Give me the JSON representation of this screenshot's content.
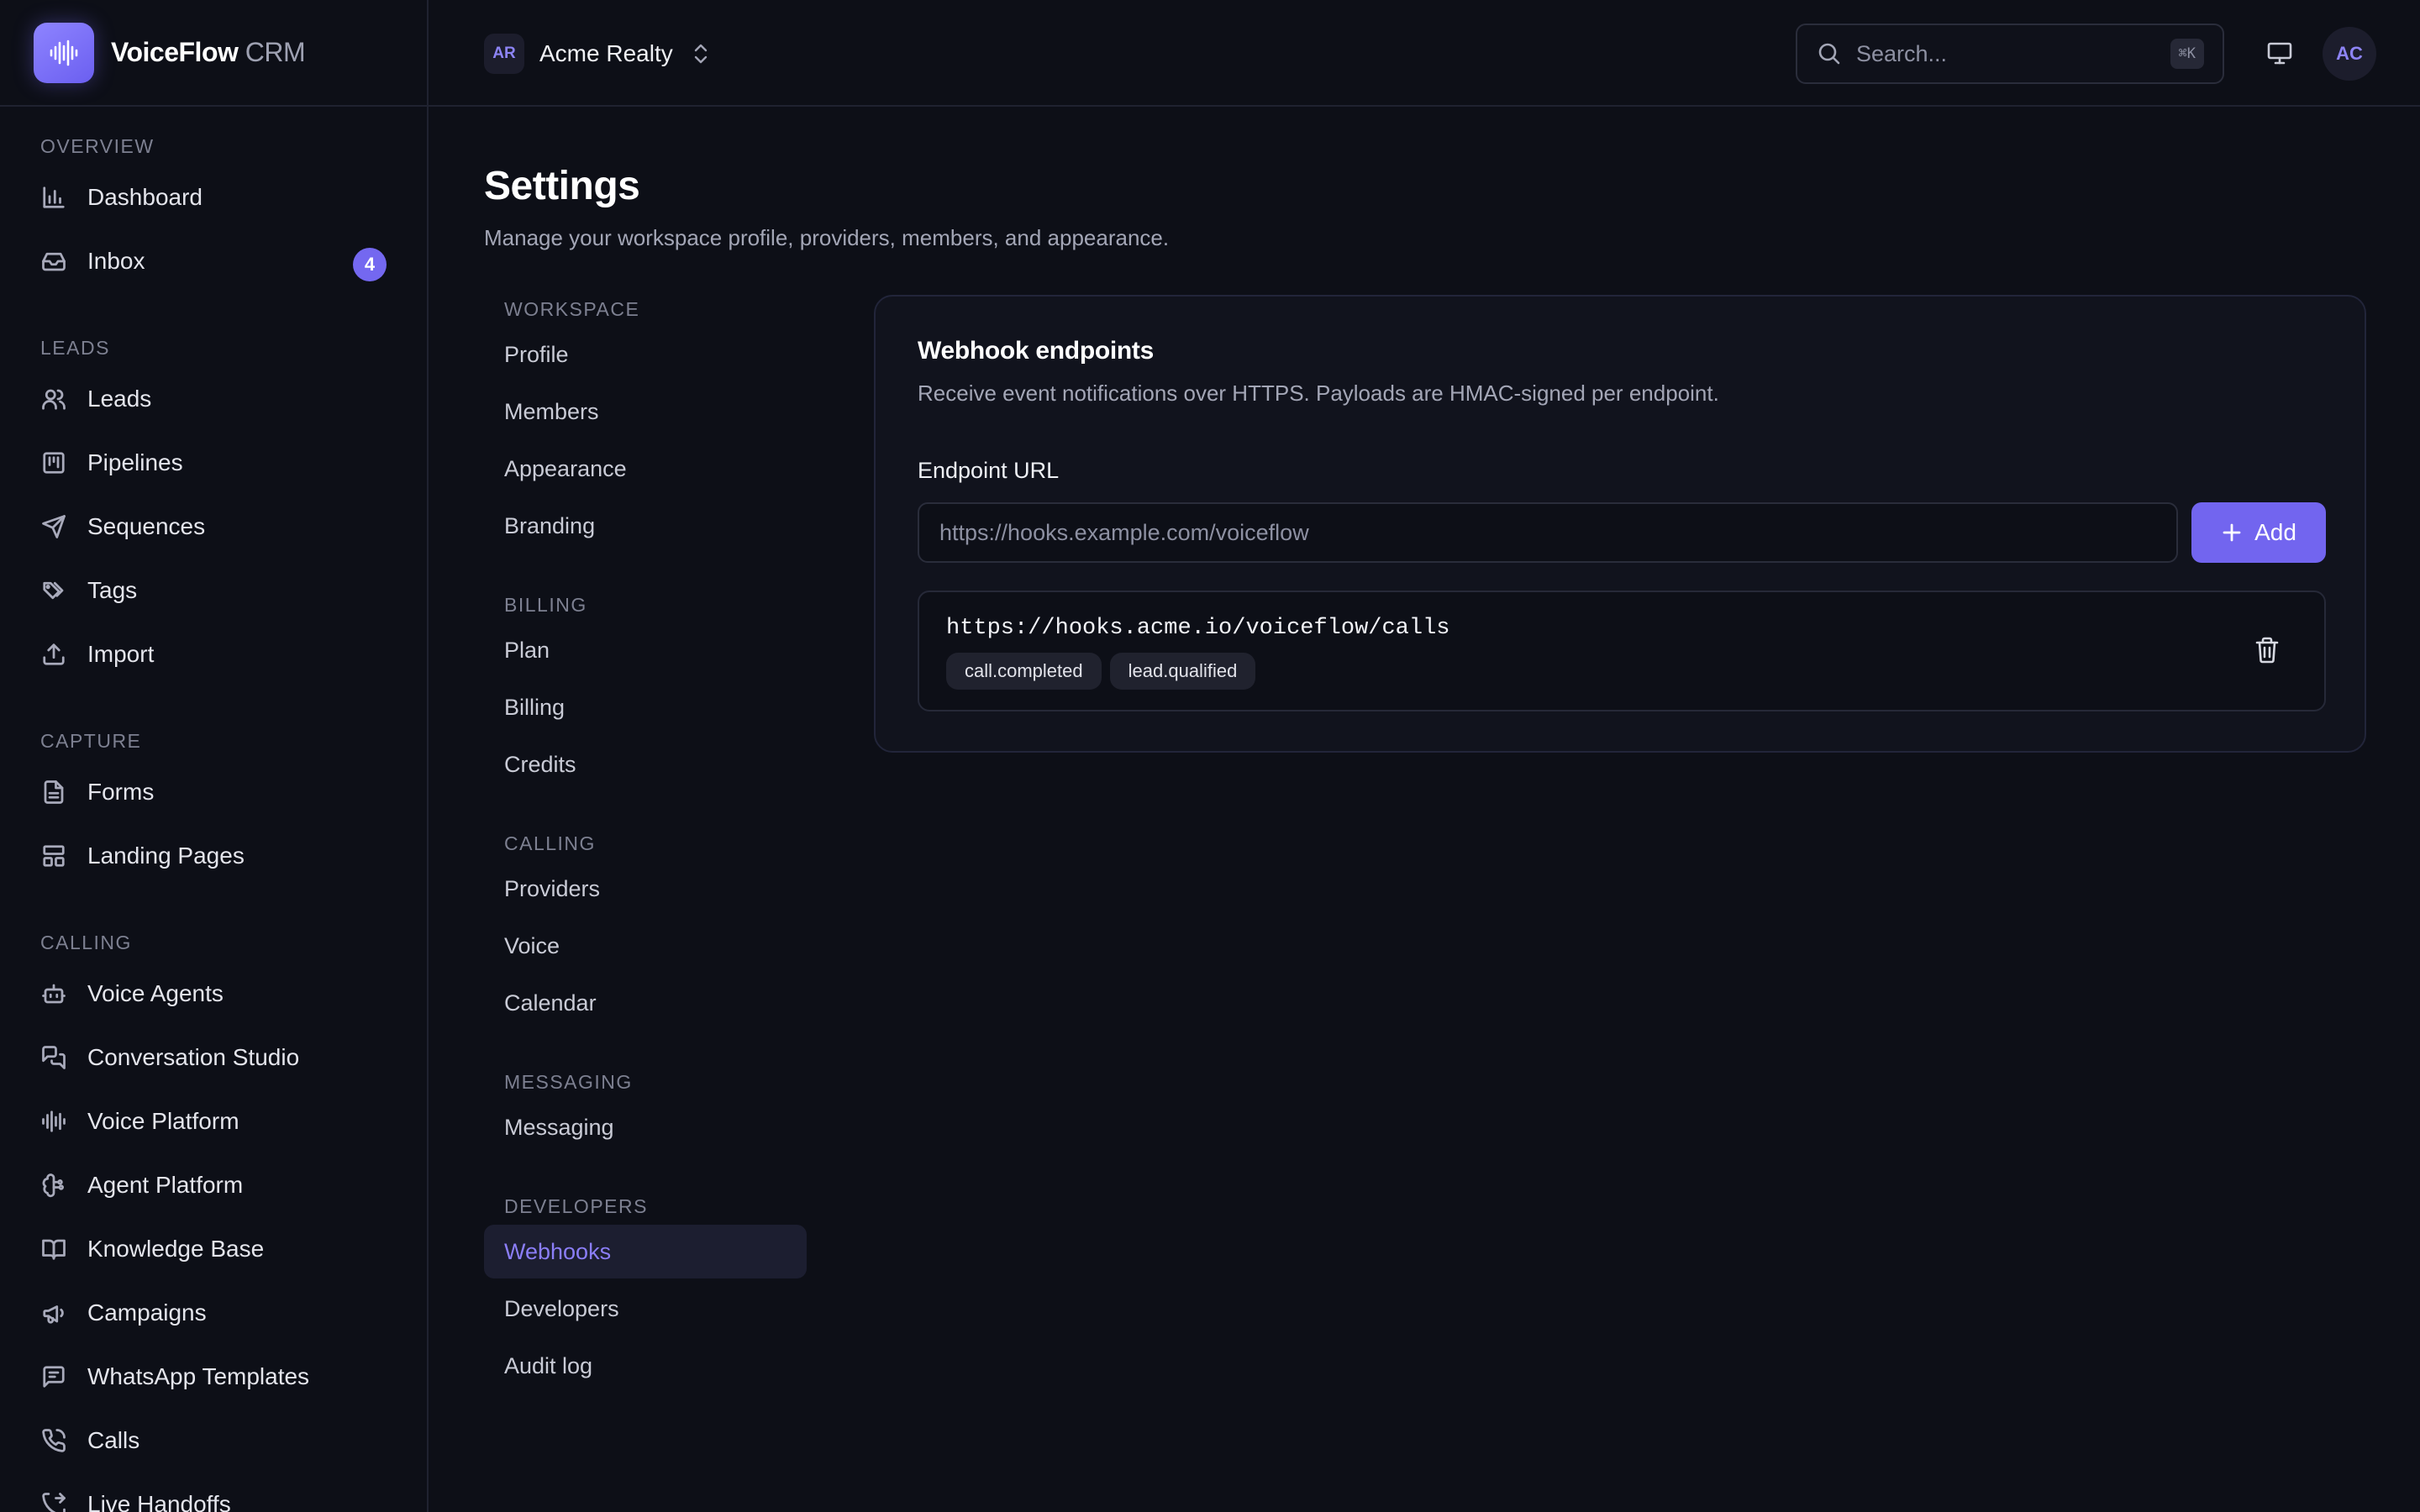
{
  "app": {
    "name": "VoiceFlow",
    "name_suffix": "CRM",
    "accent": "#7468f0",
    "background": "#0d0f17"
  },
  "sidebar": {
    "sections": [
      {
        "label": "OVERVIEW",
        "items": [
          {
            "label": "Dashboard",
            "icon": "bar-chart-icon"
          },
          {
            "label": "Inbox",
            "icon": "inbox-icon",
            "badge": "4"
          }
        ]
      },
      {
        "label": "LEADS",
        "items": [
          {
            "label": "Leads",
            "icon": "users-icon"
          },
          {
            "label": "Pipelines",
            "icon": "kanban-icon"
          },
          {
            "label": "Sequences",
            "icon": "send-icon"
          },
          {
            "label": "Tags",
            "icon": "tags-icon"
          },
          {
            "label": "Import",
            "icon": "upload-icon"
          }
        ]
      },
      {
        "label": "CAPTURE",
        "items": [
          {
            "label": "Forms",
            "icon": "file-text-icon"
          },
          {
            "label": "Landing Pages",
            "icon": "layout-icon"
          }
        ]
      },
      {
        "label": "CALLING",
        "items": [
          {
            "label": "Voice Agents",
            "icon": "bot-icon"
          },
          {
            "label": "Conversation Studio",
            "icon": "messages-icon"
          },
          {
            "label": "Voice Platform",
            "icon": "audio-lines-icon"
          },
          {
            "label": "Agent Platform",
            "icon": "brain-icon"
          },
          {
            "label": "Knowledge Base",
            "icon": "book-open-icon"
          },
          {
            "label": "Campaigns",
            "icon": "megaphone-icon"
          },
          {
            "label": "WhatsApp Templates",
            "icon": "message-square-icon"
          },
          {
            "label": "Calls",
            "icon": "phone-icon"
          },
          {
            "label": "Live Handoffs",
            "icon": "phone-forward-icon"
          }
        ]
      }
    ]
  },
  "topbar": {
    "workspace_initials": "AR",
    "workspace_name": "Acme Realty",
    "search_placeholder": "Search...",
    "search_shortcut": "⌘K",
    "user_initials": "AC"
  },
  "page": {
    "title": "Settings",
    "subtitle": "Manage your workspace profile, providers, members, and appearance."
  },
  "settings_nav": {
    "sections": [
      {
        "label": "WORKSPACE",
        "items": [
          {
            "label": "Profile"
          },
          {
            "label": "Members"
          },
          {
            "label": "Appearance"
          },
          {
            "label": "Branding"
          }
        ]
      },
      {
        "label": "BILLING",
        "items": [
          {
            "label": "Plan"
          },
          {
            "label": "Billing"
          },
          {
            "label": "Credits"
          }
        ]
      },
      {
        "label": "CALLING",
        "items": [
          {
            "label": "Providers"
          },
          {
            "label": "Voice"
          },
          {
            "label": "Calendar"
          }
        ]
      },
      {
        "label": "MESSAGING",
        "items": [
          {
            "label": "Messaging"
          }
        ]
      },
      {
        "label": "DEVELOPERS",
        "items": [
          {
            "label": "Webhooks",
            "active": true
          },
          {
            "label": "Developers"
          },
          {
            "label": "Audit log"
          }
        ]
      }
    ]
  },
  "webhooks": {
    "title": "Webhook endpoints",
    "description": "Receive event notifications over HTTPS. Payloads are HMAC-signed per endpoint.",
    "field_label": "Endpoint URL",
    "input_placeholder": "https://hooks.example.com/voiceflow",
    "add_label": "Add",
    "endpoints": [
      {
        "url": "https://hooks.acme.io/voiceflow/calls",
        "events": [
          "call.completed",
          "lead.qualified"
        ]
      }
    ]
  }
}
